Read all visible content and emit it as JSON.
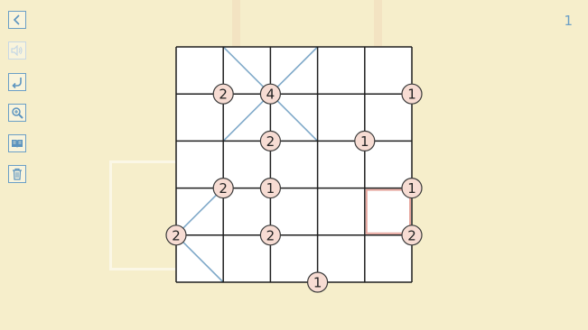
{
  "level_number": "1",
  "toolbar": {
    "items": [
      {
        "name": "back-button",
        "icon": "chevron-left-icon",
        "enabled": true
      },
      {
        "name": "sound-button",
        "icon": "speaker-icon",
        "enabled": false
      },
      {
        "name": "undo-button",
        "icon": "undo-arrow-icon",
        "enabled": true
      },
      {
        "name": "zoom-button",
        "icon": "magnifier-icon",
        "enabled": true
      },
      {
        "name": "rules-button",
        "icon": "open-book-icon",
        "enabled": true
      },
      {
        "name": "clear-button",
        "icon": "trash-icon",
        "enabled": true
      }
    ]
  },
  "puzzle": {
    "type": "gokigen-slant",
    "rows": 5,
    "cols": 5,
    "colors": {
      "cell_bg": "#ffffff",
      "grid_line": "#1f1f1f",
      "slant_line": "#7fa9c9",
      "clue_fill": "#f7dcd3",
      "clue_stroke": "#3a3a3a",
      "cursor": "#e7a79e"
    },
    "cursor_cell": {
      "row": 3,
      "col": 4
    },
    "slants": [
      {
        "row": 0,
        "col": 1,
        "dir": "\\"
      },
      {
        "row": 0,
        "col": 2,
        "dir": "/"
      },
      {
        "row": 1,
        "col": 1,
        "dir": "/"
      },
      {
        "row": 1,
        "col": 2,
        "dir": "\\"
      },
      {
        "row": 3,
        "col": 0,
        "dir": "/"
      },
      {
        "row": 4,
        "col": 0,
        "dir": "\\"
      }
    ],
    "clues": [
      {
        "vr": 1,
        "vc": 1,
        "value": "2"
      },
      {
        "vr": 1,
        "vc": 2,
        "value": "4"
      },
      {
        "vr": 1,
        "vc": 5,
        "value": "1"
      },
      {
        "vr": 2,
        "vc": 2,
        "value": "2"
      },
      {
        "vr": 2,
        "vc": 4,
        "value": "1"
      },
      {
        "vr": 3,
        "vc": 1,
        "value": "2"
      },
      {
        "vr": 3,
        "vc": 2,
        "value": "1"
      },
      {
        "vr": 3,
        "vc": 5,
        "value": "1"
      },
      {
        "vr": 4,
        "vc": 0,
        "value": "2"
      },
      {
        "vr": 4,
        "vc": 2,
        "value": "2"
      },
      {
        "vr": 4,
        "vc": 5,
        "value": "2"
      },
      {
        "vr": 5,
        "vc": 3,
        "value": "1"
      }
    ]
  }
}
